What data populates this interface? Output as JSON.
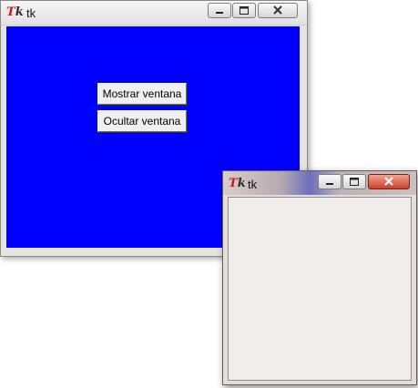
{
  "main_window": {
    "title": "tk",
    "client_bg": "#0000ff",
    "buttons": {
      "show": "Mostrar ventana",
      "hide": "Ocultar ventana"
    }
  },
  "second_window": {
    "title": "tk"
  },
  "icons": {
    "app": "tk-feather-icon",
    "minimize": "minimize-icon",
    "maximize": "maximize-icon",
    "close": "close-icon"
  },
  "colors": {
    "close_red": "#c8402a"
  }
}
